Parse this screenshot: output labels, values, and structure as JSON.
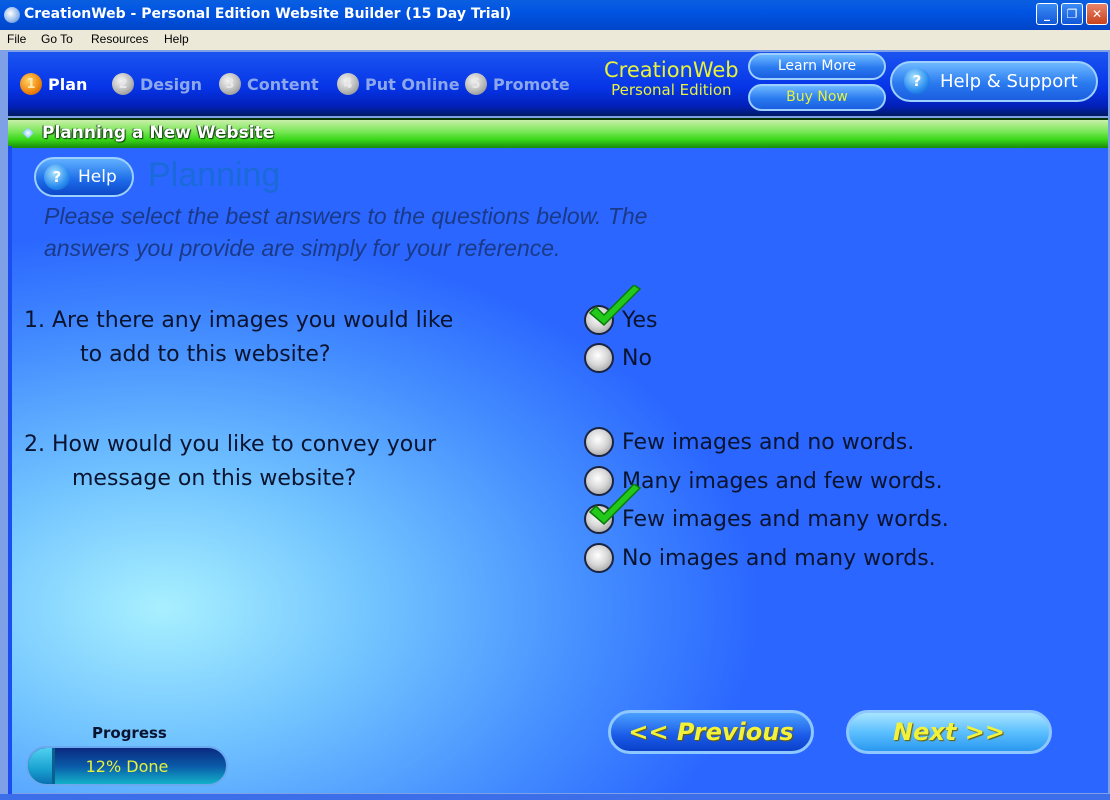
{
  "window": {
    "title": "CreationWeb - Personal Edition Website Builder (15 Day Trial)",
    "controls": [
      "minimize",
      "restore",
      "close"
    ]
  },
  "menubar": {
    "items": [
      "File",
      "Go To",
      "Resources",
      "Help"
    ]
  },
  "header": {
    "steps": [
      {
        "num": "1",
        "label": "Plan",
        "active": true
      },
      {
        "num": "2",
        "label": "Design",
        "active": false
      },
      {
        "num": "3",
        "label": "Content",
        "active": false
      },
      {
        "num": "4",
        "label": "Put Online",
        "active": false
      },
      {
        "num": "5",
        "label": "Promote",
        "active": false
      }
    ],
    "brand_line1": "CreationWeb",
    "brand_line2": "Personal Edition",
    "learn_more": "Learn More",
    "buy_now": "Buy Now",
    "help_support": "Help & Support",
    "help_icon": "?"
  },
  "section": {
    "title": "Planning a New Website"
  },
  "main": {
    "help_button": "Help",
    "help_icon": "?",
    "page_title": "Planning",
    "instructions": "Please select the best answers to the questions below. The answers you provide are simply for your reference.",
    "questions": [
      {
        "line1": "1. Are there any images you would like",
        "line2": "to add to this website?",
        "options": [
          {
            "label": "Yes",
            "selected": true
          },
          {
            "label": "No",
            "selected": false
          }
        ]
      },
      {
        "line1": "2. How would you like to convey your",
        "line2": "message on this website?",
        "options": [
          {
            "label": "Few images and no words.",
            "selected": false
          },
          {
            "label": "Many images and few words.",
            "selected": false
          },
          {
            "label": "Few images and many words.",
            "selected": true
          },
          {
            "label": "No images and many words.",
            "selected": false
          }
        ]
      }
    ]
  },
  "progress": {
    "label": "Progress",
    "percent": 12,
    "text": "12% Done"
  },
  "navigation": {
    "previous": "<< Previous",
    "next": "Next >>"
  },
  "colors": {
    "accent_yellow": "#e6f23c",
    "header_blue": "#0635e8",
    "section_green": "#38d818",
    "title_blue": "#1a6ad8",
    "check_green": "#22c81a"
  }
}
